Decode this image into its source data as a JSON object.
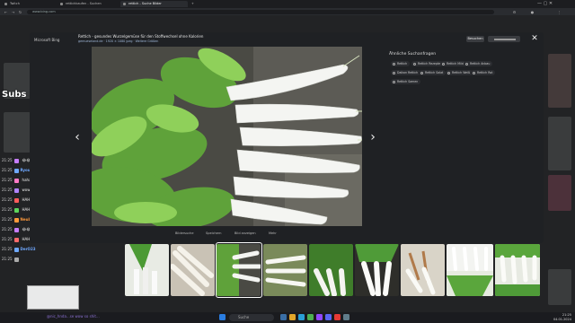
{
  "browser": {
    "tabs": [
      {
        "label": "Twitch",
        "active": false
      },
      {
        "label": "rettichkaufen - Suchen",
        "active": false
      },
      {
        "label": "rettich - Suche Bilder",
        "active": true
      },
      {
        "label": "",
        "active": false
      }
    ],
    "url": "www.bing.com"
  },
  "overlay": {
    "subs": "Subs 3101"
  },
  "chat": [
    {
      "time": "21:25",
      "user": "",
      "text": "😂😂😂",
      "color": "#c77dff"
    },
    {
      "time": "21:25",
      "user": "Ryougaao",
      "text": "HAHAHAHAHAHAHA",
      "color": "#6fa8ff"
    },
    {
      "time": "21:25",
      "user": "",
      "text": "hahahahahah",
      "color": "#ff7ac6"
    },
    {
      "time": "21:25",
      "user": "",
      "text": "wow",
      "color": "#b084ff"
    },
    {
      "time": "21:25",
      "user": "",
      "text": "HAHAHAHAHAHAHA",
      "color": "#ff5c5c"
    },
    {
      "time": "21:25",
      "user": "",
      "text": "HAHAHAHAHAHA",
      "color": "#5cd65c"
    },
    {
      "time": "21:25",
      "user": "Neubis12",
      "text": "das ist ein schöner Rettich",
      "color": "#ff9a3c"
    },
    {
      "time": "21:25",
      "user": "",
      "text": "😂😂😂😂",
      "color": "#c77dff"
    },
    {
      "time": "21:25",
      "user": "",
      "text": "HAHAHAHAHAHAHAHA",
      "color": "#ff6b6b"
    },
    {
      "time": "21:25",
      "user": "DerO23",
      "text": "",
      "color": "#6fa8ff"
    },
    {
      "time": "21:25",
      "user": "",
      "text": "",
      "color": "#aaa"
    }
  ],
  "modal": {
    "logo": "Microsoft Bing",
    "title": "Rettich - gesundes Wurzelgemüse für den Stoffwechsel ohne Kalorien",
    "subtitle": "gemueseland.de · 1920 × 1080 jpeg · Weitere Größen",
    "visit_label": "Besuchen",
    "close_icon": "✕",
    "similar_heading": "Ähnliche Suchanfragen",
    "chips": [
      "Rettich",
      "Rettich Rezepte",
      "Rettich Mild",
      "Rettich Anbau",
      "Daikon Rettich",
      "Rettich Salat",
      "Rettich Weiß",
      "Rettich Rot",
      "Rettich Samen"
    ],
    "actions": [
      "Bildersuche",
      "Speichern",
      "Bild anzeigen",
      "Mehr"
    ]
  },
  "taskbar": {
    "search_placeholder": "Suche",
    "time": "21:25",
    "date": "04.01.2024"
  },
  "bottom_chat": "@nic_hnda...se wow so shit..."
}
